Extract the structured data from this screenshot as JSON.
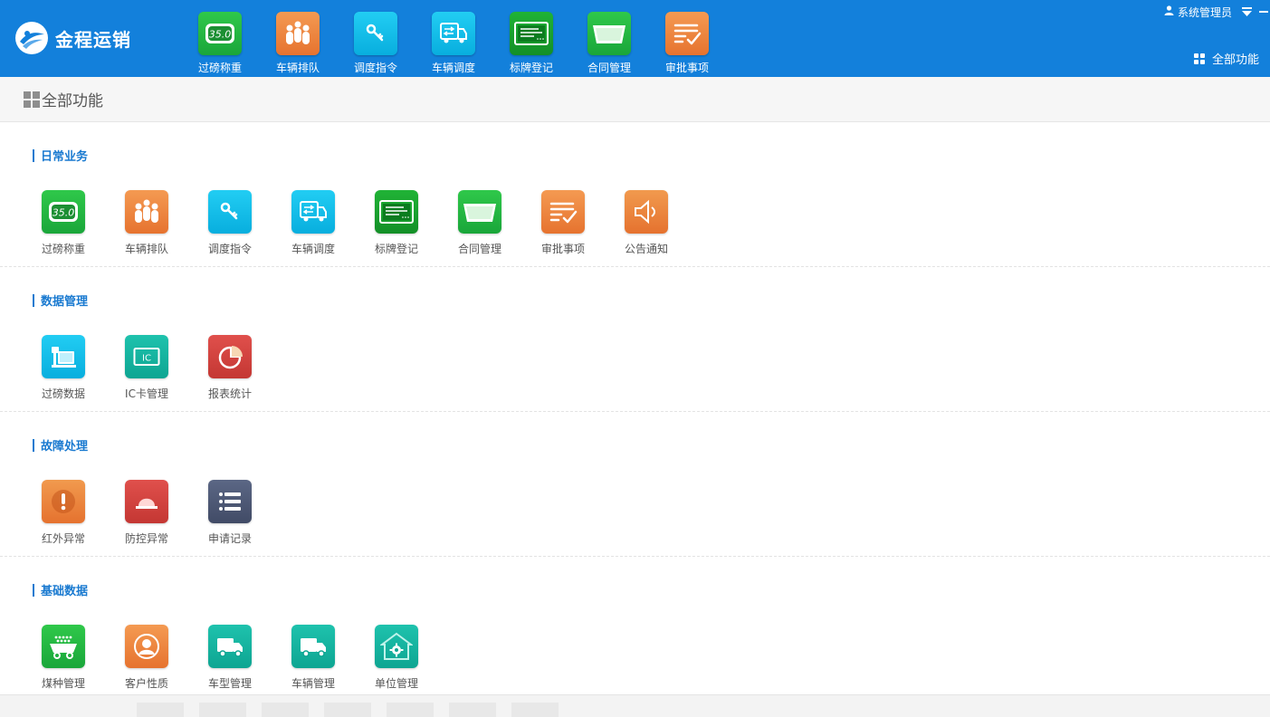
{
  "brand": {
    "name": "金程运销"
  },
  "topnav": [
    {
      "label": "过磅称重",
      "icon": "scale-display-icon",
      "color": "green"
    },
    {
      "label": "车辆排队",
      "icon": "queue-people-icon",
      "color": "orange"
    },
    {
      "label": "调度指令",
      "icon": "key-icon",
      "color": "cyan"
    },
    {
      "label": "车辆调度",
      "icon": "truck-transfer-icon",
      "color": "cyan"
    },
    {
      "label": "标牌登记",
      "icon": "license-board-icon",
      "color": "dgreen"
    },
    {
      "label": "合同管理",
      "icon": "folder-tray-icon",
      "color": "green"
    },
    {
      "label": "审批事项",
      "icon": "checklist-icon",
      "color": "orange"
    }
  ],
  "user": {
    "name": "系统管理员"
  },
  "all_functions_label": "全部功能",
  "page_title": "全部功能",
  "scale_display_value": "35.0",
  "sections": [
    {
      "title": "日常业务",
      "items": [
        {
          "label": "过磅称重",
          "icon": "scale-display-icon",
          "color": "green"
        },
        {
          "label": "车辆排队",
          "icon": "queue-people-icon",
          "color": "orange"
        },
        {
          "label": "调度指令",
          "icon": "key-icon",
          "color": "cyan"
        },
        {
          "label": "车辆调度",
          "icon": "truck-transfer-icon",
          "color": "cyan"
        },
        {
          "label": "标牌登记",
          "icon": "license-board-icon",
          "color": "dgreen"
        },
        {
          "label": "合同管理",
          "icon": "folder-tray-icon",
          "color": "green"
        },
        {
          "label": "审批事项",
          "icon": "checklist-icon",
          "color": "orange"
        },
        {
          "label": "公告通知",
          "icon": "speaker-icon",
          "color": "eorange"
        }
      ]
    },
    {
      "title": "数据管理",
      "items": [
        {
          "label": "过磅数据",
          "icon": "weigh-data-icon",
          "color": "cyan"
        },
        {
          "label": "IC卡管理",
          "icon": "ic-card-icon",
          "color": "teal",
          "icon_text": "IC"
        },
        {
          "label": "报表统计",
          "icon": "pie-chart-icon",
          "color": "red"
        }
      ]
    },
    {
      "title": "故障处理",
      "items": [
        {
          "label": "红外异常",
          "icon": "exclamation-icon",
          "color": "eorange"
        },
        {
          "label": "防控异常",
          "icon": "alarm-light-icon",
          "color": "red"
        },
        {
          "label": "申请记录",
          "icon": "list-icon",
          "color": "slate"
        }
      ]
    },
    {
      "title": "基础数据",
      "items": [
        {
          "label": "煤种管理",
          "icon": "coal-cart-icon",
          "color": "green"
        },
        {
          "label": "客户性质",
          "icon": "customer-icon",
          "color": "orange"
        },
        {
          "label": "车型管理",
          "icon": "truck-icon",
          "color": "teal"
        },
        {
          "label": "车辆管理",
          "icon": "truck-icon",
          "color": "teal"
        },
        {
          "label": "单位管理",
          "icon": "house-gear-icon",
          "color": "teal"
        }
      ]
    }
  ],
  "colors": {
    "topbar": "#1380db",
    "section_title": "#1a7ad0",
    "green": "#1aa63a",
    "orange": "#e6732f",
    "cyan": "#08aede",
    "teal": "#0ea592",
    "red": "#c43733",
    "slate": "#414b66"
  }
}
